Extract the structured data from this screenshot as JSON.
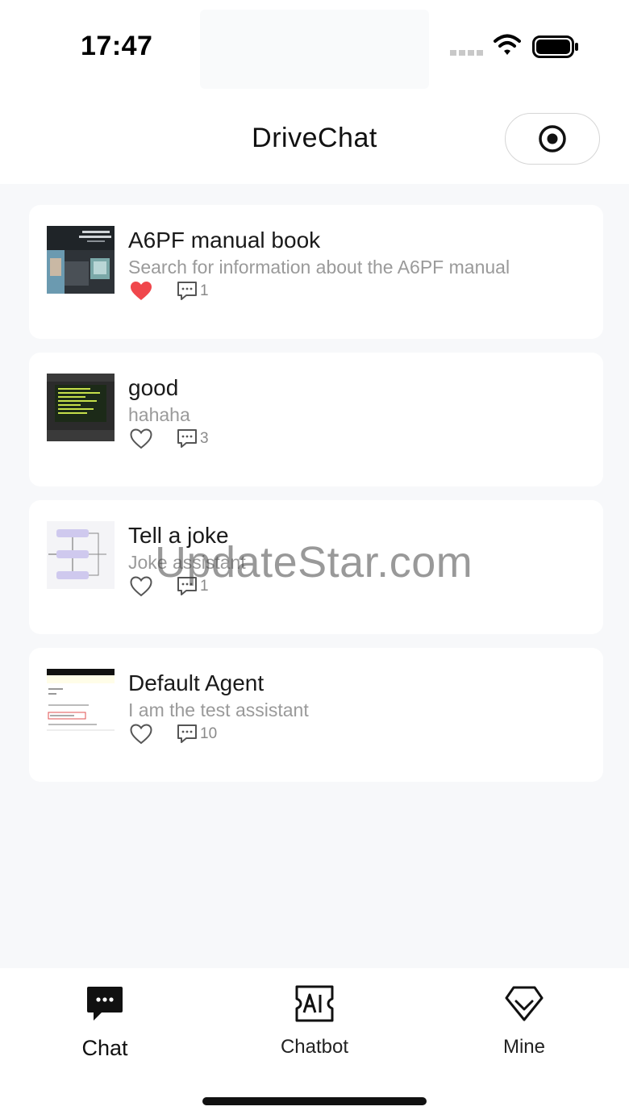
{
  "status_bar": {
    "time": "17:47"
  },
  "header": {
    "title": "DriveChat"
  },
  "colors": {
    "accent_like": "#f0474c",
    "page_bg": "#f7f8fa",
    "text_muted": "#9a9a9a"
  },
  "cards": [
    {
      "title": "A6PF manual book",
      "subtitle": "Search for information about the A6PF manual",
      "liked": true,
      "comments": "1"
    },
    {
      "title": "good",
      "subtitle": "hahaha",
      "liked": false,
      "comments": "3"
    },
    {
      "title": "Tell a joke",
      "subtitle": "Joke assistant",
      "liked": false,
      "comments": "1"
    },
    {
      "title": "Default Agent",
      "subtitle": "I am the test assistant",
      "liked": false,
      "comments": "10"
    }
  ],
  "watermark": "UpdateStar.com",
  "tabbar": {
    "items": [
      {
        "label": "Chat",
        "icon": "chat-bubble-icon",
        "active": true
      },
      {
        "label": "Chatbot",
        "icon": "ai-icon",
        "active": false
      },
      {
        "label": "Mine",
        "icon": "diamond-user-icon",
        "active": false
      }
    ]
  }
}
